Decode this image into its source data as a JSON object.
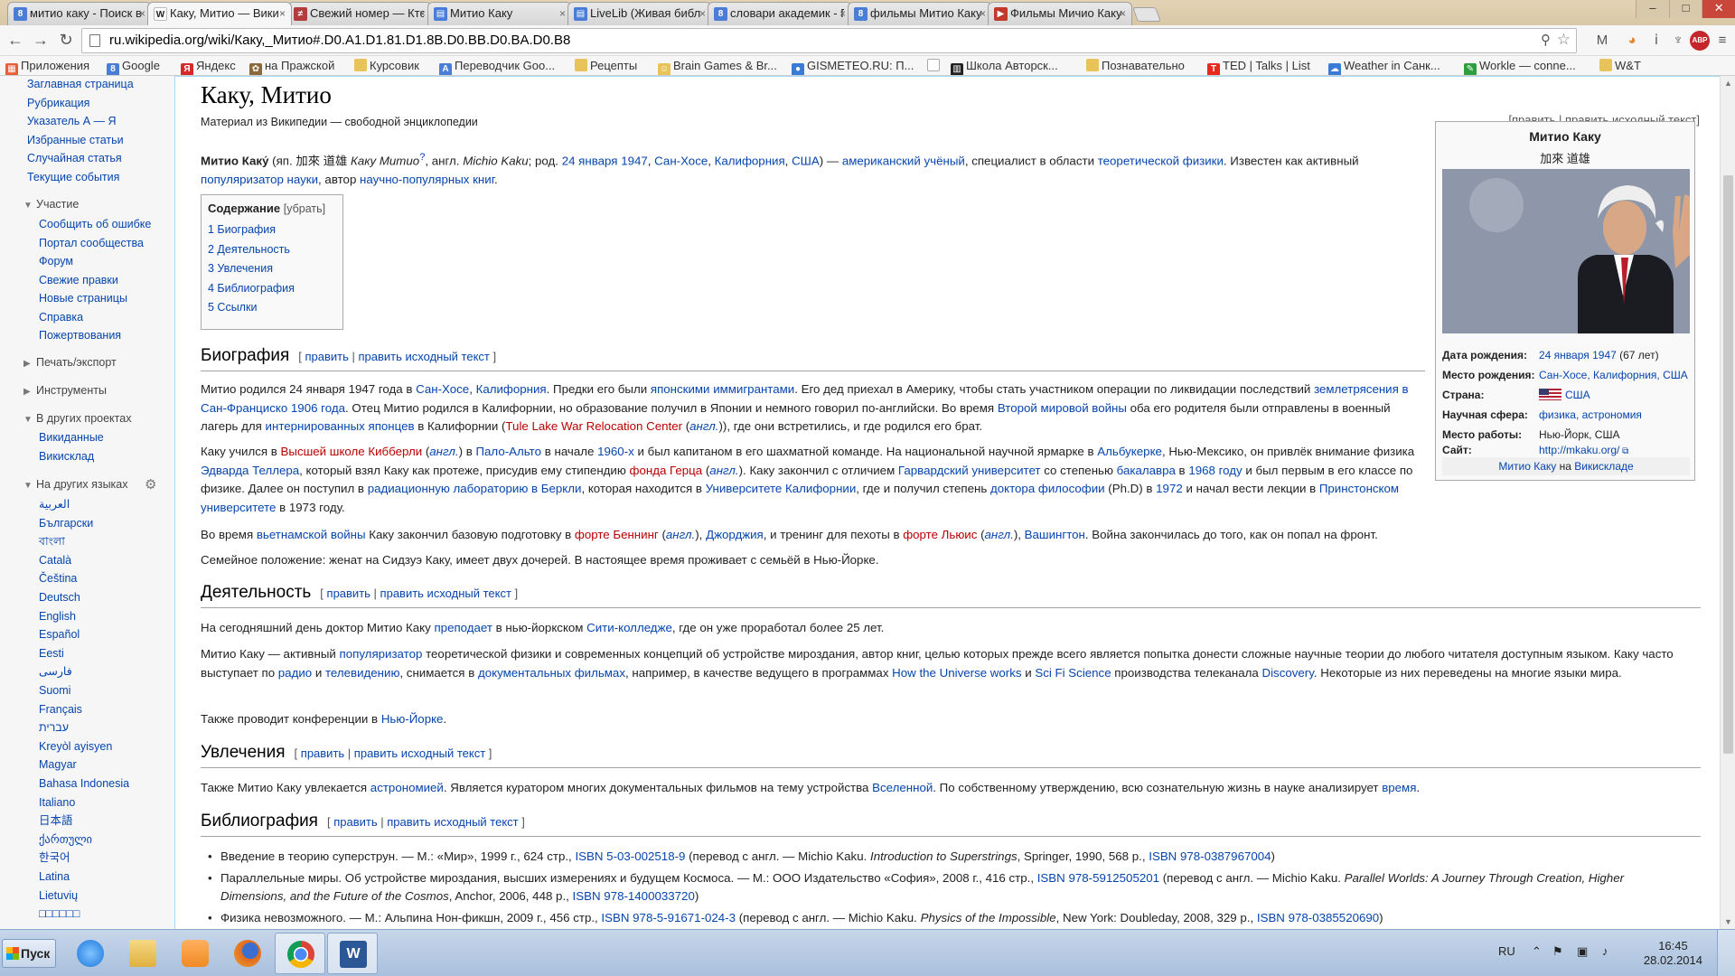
{
  "tabs": [
    {
      "label": "митио каку - Поиск в",
      "icon": "google-g-icon",
      "color": "#4a7dd6",
      "active": false
    },
    {
      "label": "Каку, Митио — Вики",
      "icon": "wikipedia-w-icon",
      "color": "#666666",
      "active": true
    },
    {
      "label": "Свежий номер — Кто",
      "icon": "magazine-icon",
      "color": "#b23b3b",
      "active": false
    },
    {
      "label": "Митио Каку",
      "icon": "page-icon",
      "color": "#4a7dd6",
      "active": false
    },
    {
      "label": "LiveLib (Живая библ",
      "icon": "livelib-icon",
      "color": "#4a7dd6",
      "active": false
    },
    {
      "label": "словари академик - Г",
      "icon": "google-g-icon",
      "color": "#4a7dd6",
      "active": false
    },
    {
      "label": "фильмы Митио Каку",
      "icon": "google-g-icon",
      "color": "#4a7dd6",
      "active": false
    },
    {
      "label": "Фильмы Мичио Каку",
      "icon": "video-icon",
      "color": "#c0392b",
      "active": false
    }
  ],
  "toolbar": {
    "url": "ru.wikipedia.org/wiki/Каку,_Митио#.D0.A1.D1.81.D1.8B.D0.BB.D0.BA.D0.B8",
    "back": "←",
    "forward": "→",
    "reload": "↻",
    "zoom": "⚲",
    "star": "☆",
    "extensions": [
      "M",
      "◕",
      "ⅰ",
      "♆",
      "ABP",
      "≡"
    ]
  },
  "bookmarks": [
    {
      "label": "Приложения",
      "icon": "apps-grid-icon",
      "color": "#e85d3a"
    },
    {
      "label": "Google",
      "icon": "google-g-icon",
      "color": "#4a7dd6"
    },
    {
      "label": "Яндекс",
      "icon": "yandex-icon",
      "color": "#d42a2a"
    },
    {
      "label": "на Пражской",
      "icon": "bird-icon",
      "color": "#8a6a3a"
    },
    {
      "label": "Курсовик",
      "icon": "folder-icon",
      "color": "#e8c35a"
    },
    {
      "label": "Переводчик Goo...",
      "icon": "translate-icon",
      "color": "#4a7dd6"
    },
    {
      "label": "Рецепты",
      "icon": "folder-icon",
      "color": "#e8c35a"
    },
    {
      "label": "Brain Games & Br...",
      "icon": "brain-icon",
      "color": "#e8c35a"
    },
    {
      "label": "GISMETEO.RU: П...",
      "icon": "weather-drop-icon",
      "color": "#3a7bd5"
    },
    {
      "label": "",
      "icon": "blank-page-icon",
      "color": "#dddddd"
    },
    {
      "label": "Школа Авторск...",
      "icon": "piano-icon",
      "color": "#222222"
    },
    {
      "label": "Познавательно",
      "icon": "folder-icon",
      "color": "#e8c35a"
    },
    {
      "label": "TED | Talks | List",
      "icon": "ted-icon",
      "color": "#e62b1e"
    },
    {
      "label": "Weather in Санк...",
      "icon": "weather-cloud-icon",
      "color": "#3a7bd5"
    },
    {
      "label": "Workle — conne...",
      "icon": "workle-icon",
      "color": "#2e9e3e"
    },
    {
      "label": "W&T",
      "icon": "folder-icon",
      "color": "#e8c35a"
    }
  ],
  "sidebar": {
    "nav": [
      "Заглавная страница",
      "Рубрикация",
      "Указатель А — Я",
      "Избранные статьи",
      "Случайная статья",
      "Текущие события"
    ],
    "participation_title": "Участие",
    "participation": [
      "Сообщить об ошибке",
      "Портал сообщества",
      "Форум",
      "Свежие правки",
      "Новые страницы",
      "Справка",
      "Пожертвования"
    ],
    "print_title": "Печать/экспорт",
    "tools_title": "Инструменты",
    "projects_title": "В других проектах",
    "projects": [
      "Викиданные",
      "Викисклад"
    ],
    "languages_title": "На других языках",
    "languages": [
      "العربية",
      "Български",
      "বাংলা",
      "Català",
      "Čeština",
      "Deutsch",
      "English",
      "Español",
      "Eesti",
      "فارسی",
      "Suomi",
      "Français",
      "עברית",
      "Kreyòl ayisyen",
      "Magyar",
      "Bahasa Indonesia",
      "Italiano",
      "日本語",
      "ქართული",
      "한국어",
      "Latina",
      "Lietuvių",
      "□□□□□□"
    ]
  },
  "article": {
    "title": "Каку, Митио",
    "subtitle": "Материал из Википедии — свободной энциклопедии",
    "top_edit": "[править | править исходный текст]",
    "toc": {
      "title": "Содержание",
      "toggle": "[убрать]",
      "items": [
        "1 Биография",
        "2 Деятельность",
        "3 Увлечения",
        "4 Библиография",
        "5 Ссылки"
      ]
    },
    "sections": {
      "bio": "Биография",
      "work": "Деятельность",
      "hobby": "Увлечения",
      "biblio": "Библиография"
    },
    "edit_word": "править",
    "edit_source": "править исходный текст"
  },
  "infobox": {
    "name": "Митио Каку",
    "original_name": "加來 道雄",
    "photo_alt": "portrait-photo",
    "rows": [
      {
        "key": "Дата рождения:",
        "value": "24 января 1947",
        "extra": " (67 лет)"
      },
      {
        "key": "Место рождения:",
        "value": "Сан-Хосе, Калифорния, США",
        "extra": ""
      },
      {
        "key": "Страна:",
        "value": "США",
        "extra": ""
      },
      {
        "key": "Научная сфера:",
        "value": "физика, астрономия",
        "extra": ""
      },
      {
        "key": "Место работы:",
        "value": "Нью-Йорк, США",
        "extra": ""
      },
      {
        "key": "Сайт:",
        "value": "http://mkaku.org/",
        "extra": ""
      }
    ],
    "commons_link": "Митио Каку",
    "commons_prefix": " на ",
    "commons_target": "Викискладе"
  },
  "taskbar": {
    "start": "Пуск",
    "apps": [
      {
        "name": "ie-icon",
        "color": "#3a8ee6"
      },
      {
        "name": "explorer-folder-icon",
        "color": "#e8c35a"
      },
      {
        "name": "media-player-icon",
        "color": "#f08a24"
      },
      {
        "name": "firefox-icon",
        "color": "#e06a1e"
      },
      {
        "name": "chrome-icon",
        "color": "#db4437"
      },
      {
        "name": "word-icon",
        "color": "#2b5797"
      }
    ],
    "lang": "RU",
    "time": "16:45",
    "date": "28.02.2014"
  }
}
